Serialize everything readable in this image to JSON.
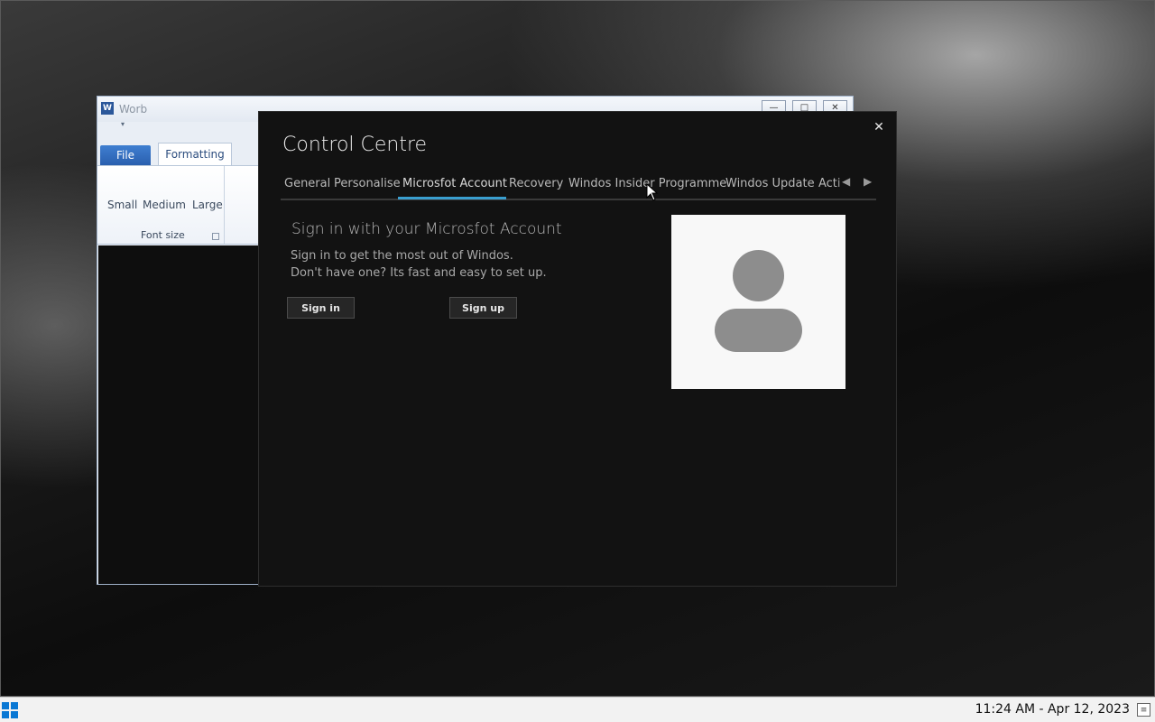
{
  "word": {
    "title": "Worb",
    "logo_letter": "W",
    "tabs": {
      "file": "File",
      "formatting": "Formatting"
    },
    "font_sizes": [
      "Small",
      "Medium",
      "Large"
    ],
    "group_label": "Font size"
  },
  "control_centre": {
    "title": "Control Centre",
    "close_glyph": "✕",
    "tabs": [
      "General",
      "Personalise",
      "Microsfot Account",
      "Recovery",
      "Windos Insider Programme",
      "Windos Update",
      "Acti"
    ],
    "active_tab": "Microsfot Account",
    "accent_color": "#3a9fd0",
    "scroll_left": "◀",
    "scroll_right": "▶",
    "signin": {
      "heading": "Sign in with your Microsfot Account",
      "line1": "Sign in to get the most out of Windos.",
      "line2": "Don't have one? Its fast and easy to set up.",
      "signin_button": "Sign in",
      "signup_button": "Sign up"
    }
  },
  "taskbar": {
    "clock": "11:24 AM - Apr 12, 2023"
  }
}
